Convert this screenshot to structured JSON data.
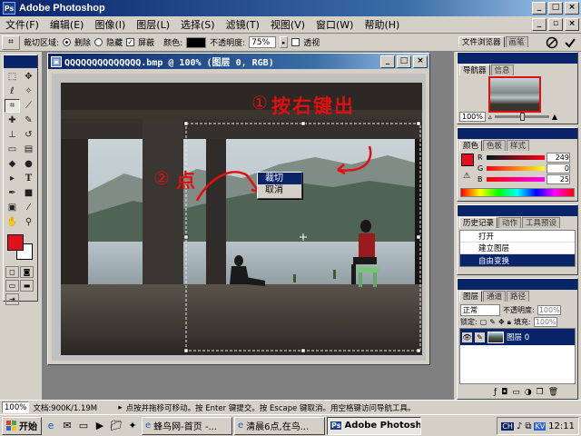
{
  "app": {
    "title": "Adobe Photoshop",
    "icon": "photoshop-icon"
  },
  "menubar": {
    "items": [
      {
        "label": "文件(F)"
      },
      {
        "label": "编辑(E)"
      },
      {
        "label": "图像(I)"
      },
      {
        "label": "图层(L)"
      },
      {
        "label": "选择(S)"
      },
      {
        "label": "滤镜(T)"
      },
      {
        "label": "视图(V)"
      },
      {
        "label": "窗口(W)"
      },
      {
        "label": "帮助(H)"
      }
    ]
  },
  "options": {
    "crop_area_label": "裁切区域:",
    "delete_label": "删除",
    "hide_label": "隐藏",
    "shield_label": "屏蔽",
    "color_label": "颜色:",
    "opacity_label": "不透明度:",
    "opacity_value": "75%",
    "perspective_label": "透视",
    "confirm_icon": "checkmark-icon",
    "cancel_icon": "cancel-icon"
  },
  "palette_well": {
    "tab1": "文件浏览器",
    "tab2": "画笔"
  },
  "document": {
    "title": "QQQQQQQQQQQQQQ.bmp @ 100% (图层 0, RGB)",
    "annotation_1": "①",
    "annotation_1_text": "按右键出",
    "annotation_2": "②",
    "annotation_2_text": "点"
  },
  "context_menu": {
    "items": [
      {
        "label": "裁切",
        "selected": true
      },
      {
        "label": "取消",
        "selected": false
      }
    ]
  },
  "navigator": {
    "tabs": [
      "导航器",
      "信息"
    ],
    "zoom": "100%"
  },
  "color_panel": {
    "tabs": [
      "颜色",
      "色板",
      "样式"
    ],
    "channels": [
      {
        "label": "R",
        "value": "249"
      },
      {
        "label": "G",
        "value": "0"
      },
      {
        "label": "B",
        "value": "25"
      }
    ]
  },
  "history_panel": {
    "tabs": [
      "历史记录",
      "动作",
      "工具预设"
    ],
    "items": [
      {
        "label": "打开",
        "active": false
      },
      {
        "label": "建立图层",
        "active": false
      },
      {
        "label": "自由变换",
        "active": true
      }
    ]
  },
  "layers_panel": {
    "tabs": [
      "图层",
      "通道",
      "路径"
    ],
    "blend_mode": "正常",
    "opacity_label": "不透明度:",
    "opacity_value": "100%",
    "lock_label": "锁定:",
    "fill_label": "填充:",
    "fill_value": "100%",
    "layers": [
      {
        "name": "图层 0",
        "selected": true
      }
    ]
  },
  "statusbar": {
    "zoom": "100%",
    "doc_info": "文档:900K/1.19M",
    "hint": "点按并拖移可移动。按 Enter 键提交。按 Escape 键取消。用空格键访问导航工具。"
  },
  "taskbar": {
    "start_label": "开始",
    "tasks": [
      {
        "label": "蜂鸟网-首页 -...",
        "active": false
      },
      {
        "label": "清晨6点,在鸟...",
        "active": false
      },
      {
        "label": "Adobe Photoshop",
        "active": true
      }
    ],
    "tray_lang": "CH",
    "tray_kv": "KV",
    "clock": "12:11"
  },
  "colors": {
    "title_bar": "#0a246a",
    "foreground_color": "#e0101c",
    "background_color": "#ffffff",
    "annotation_red": "#e01010",
    "selection_blue": "#0a246a"
  }
}
